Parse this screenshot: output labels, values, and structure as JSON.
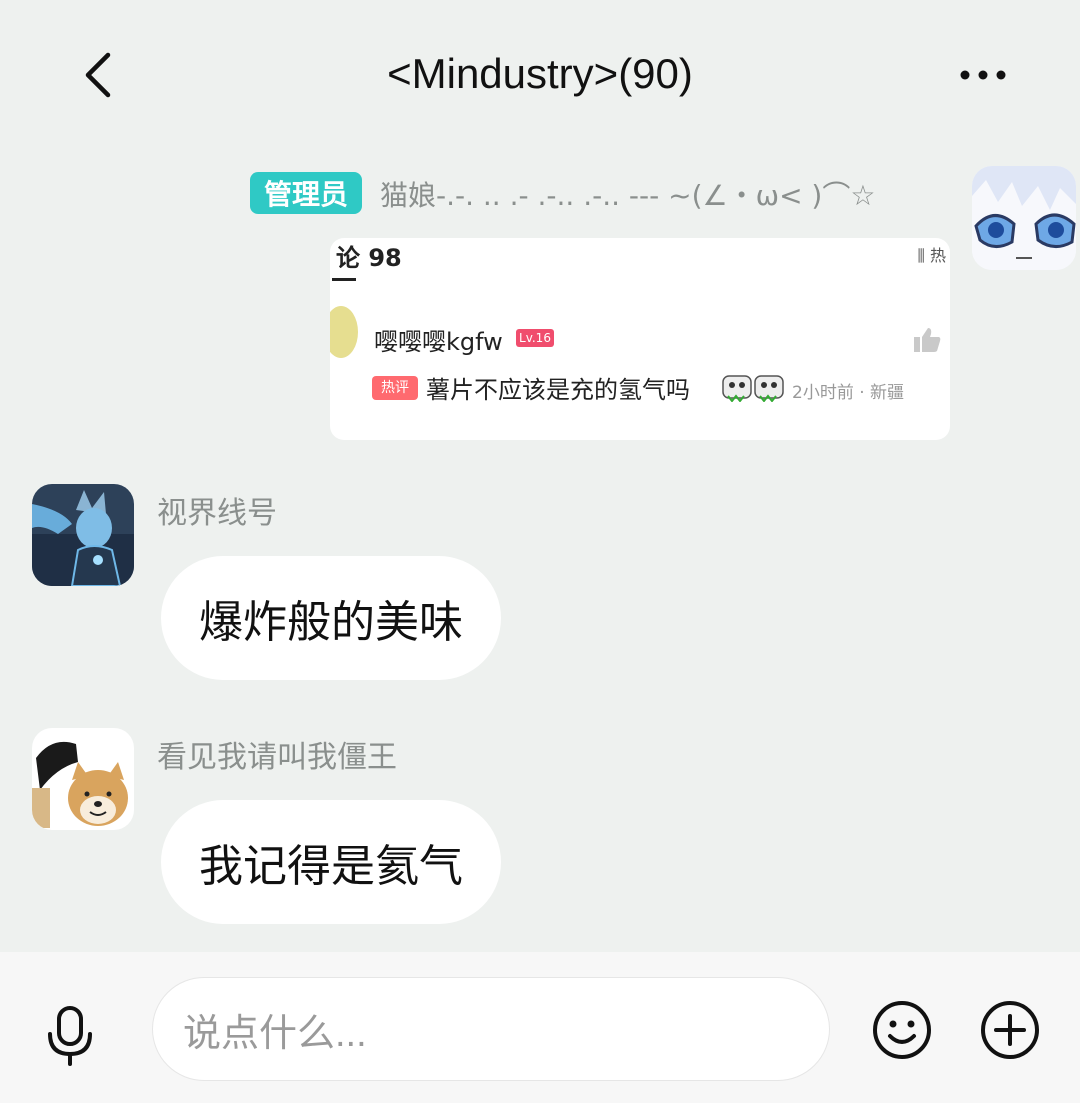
{
  "header": {
    "title": "<Mindustry>(90)",
    "back_icon": "back-arrow-icon",
    "more_icon": "more-dots-icon"
  },
  "messages": [
    {
      "sender": {
        "badge": "管理员",
        "name": "猫娘-.-. .. .- .-.. .-.. --- ~(∠・ω< )⌒☆",
        "badge_color": "#2fc9c5"
      },
      "type": "image",
      "image_card": {
        "comments_header": "论 98",
        "sort_label": "热",
        "user": "嘤嘤嘤kgfw",
        "level": "Lv.16",
        "hot_tag": "热评",
        "comment": "薯片不应该是充的氢气吗",
        "time_location": "2小时前 · 新疆"
      }
    },
    {
      "sender": {
        "name": "视界线号"
      },
      "type": "text",
      "text": "爆炸般的美味"
    },
    {
      "sender": {
        "name": "看见我请叫我僵王"
      },
      "type": "text",
      "text": "我记得是氦气"
    }
  ],
  "input": {
    "placeholder": "说点什么..."
  },
  "icons": {
    "mic": "microphone-icon",
    "emoji": "emoji-icon",
    "plus": "plus-icon"
  },
  "colors": {
    "background": "#eef1ef",
    "bubble": "#ffffff",
    "admin_badge": "#2fc9c5",
    "level_badge": "#f04d6d"
  }
}
